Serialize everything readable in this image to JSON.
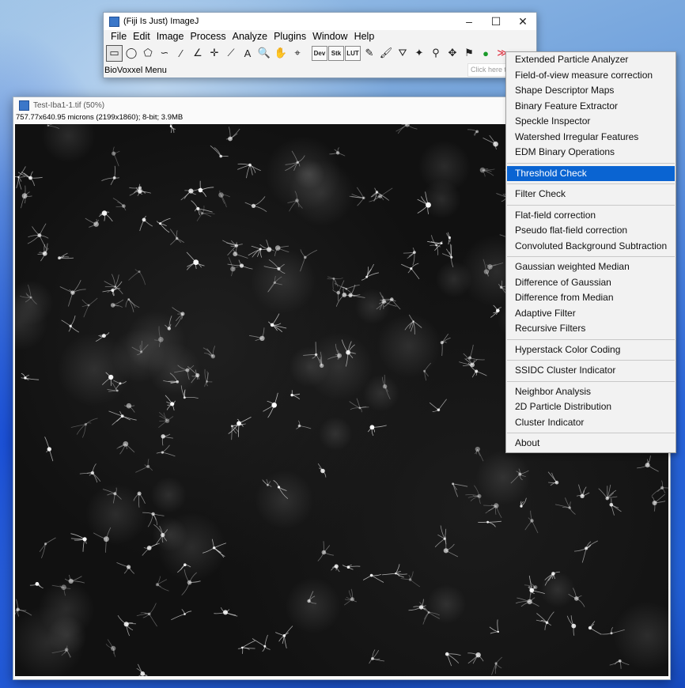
{
  "ij_window": {
    "title": "(Fiji Is Just) ImageJ",
    "controls": {
      "minimize": "–",
      "maximize": "☐",
      "close": "✕"
    },
    "menus": [
      "File",
      "Edit",
      "Image",
      "Process",
      "Analyze",
      "Plugins",
      "Window",
      "Help"
    ],
    "tools": {
      "rectangle": "▭",
      "oval": "◯",
      "polygon": "⬠",
      "freehand": "∽",
      "line": "⁄",
      "angle": "∠",
      "point": "✛",
      "wand": "⟋",
      "text": "A",
      "magnifier": "🔍",
      "hand": "✋",
      "dropper": "⌖",
      "dev": "Dev",
      "stk": "Stk",
      "lut": "LUT",
      "pencil": "✎",
      "brush": "🖌",
      "flood": "⛛",
      "sparkle": "✦",
      "magnify2": "⚲",
      "move": "✥",
      "custom": "⚑",
      "green_dot": "●",
      "more": "≫"
    },
    "status_text": "BioVoxxel Menu",
    "search_placeholder": "Click here to search"
  },
  "image_window": {
    "title": "Test-Iba1-1.tif (50%)",
    "info": "757.77x640.95 microns (2199x1860); 8-bit; 3.9MB"
  },
  "popup_menu": {
    "groups": [
      [
        "Extended Particle Analyzer",
        "Field-of-view measure correction",
        "Shape Descriptor Maps",
        "Binary Feature Extractor",
        "Speckle Inspector",
        "Watershed Irregular Features",
        "EDM Binary Operations"
      ],
      [
        "Threshold Check"
      ],
      [
        "Filter Check"
      ],
      [
        "Flat-field correction",
        "Pseudo flat-field correction",
        "Convoluted Background Subtraction"
      ],
      [
        "Gaussian weighted Median",
        "Difference of Gaussian",
        "Difference from Median",
        "Adaptive Filter",
        "Recursive Filters"
      ],
      [
        "Hyperstack Color Coding"
      ],
      [
        "SSIDC Cluster Indicator"
      ],
      [
        "Neighbor Analysis",
        "2D Particle Distribution",
        "Cluster Indicator"
      ],
      [
        "About"
      ]
    ],
    "active": "Threshold Check"
  },
  "colors": {
    "menu_highlight": "#0a64d2",
    "desktop_blue": "#2a64d8"
  }
}
